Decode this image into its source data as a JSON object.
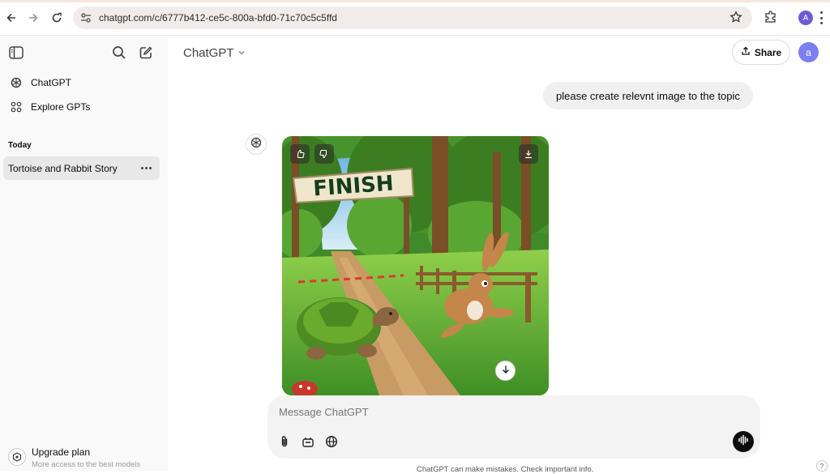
{
  "browser": {
    "url": "chatgpt.com/c/6777b412-ce5c-800a-bfd0-71c70c5c5ffd",
    "profile_initial": "A"
  },
  "sidebar": {
    "nav_items": [
      {
        "label": "ChatGPT",
        "icon": "openai-logo-icon"
      },
      {
        "label": "Explore GPTs",
        "icon": "grid-icon"
      }
    ],
    "section_today": "Today",
    "chats": [
      {
        "label": "Tortoise and Rabbit Story"
      }
    ],
    "upgrade": {
      "title": "Upgrade plan",
      "subtitle": "More access to the best models"
    }
  },
  "header": {
    "model_title": "ChatGPT",
    "share_label": "Share",
    "avatar_initial": "a"
  },
  "conversation": {
    "user_message": "please create relevnt image to the topic",
    "image": {
      "banner_text": "FINISH",
      "description_icons": [
        "thumbs-up-icon",
        "thumbs-down-icon",
        "download-icon"
      ]
    }
  },
  "composer": {
    "placeholder": "Message ChatGPT"
  },
  "footer": {
    "disclaimer": "ChatGPT can make mistakes. Check important info.",
    "help": "?"
  },
  "colors": {
    "sidebar_bg": "#f9f9f9",
    "avatar": "#7c7ff0",
    "profile_chip": "#6f5ad6"
  }
}
